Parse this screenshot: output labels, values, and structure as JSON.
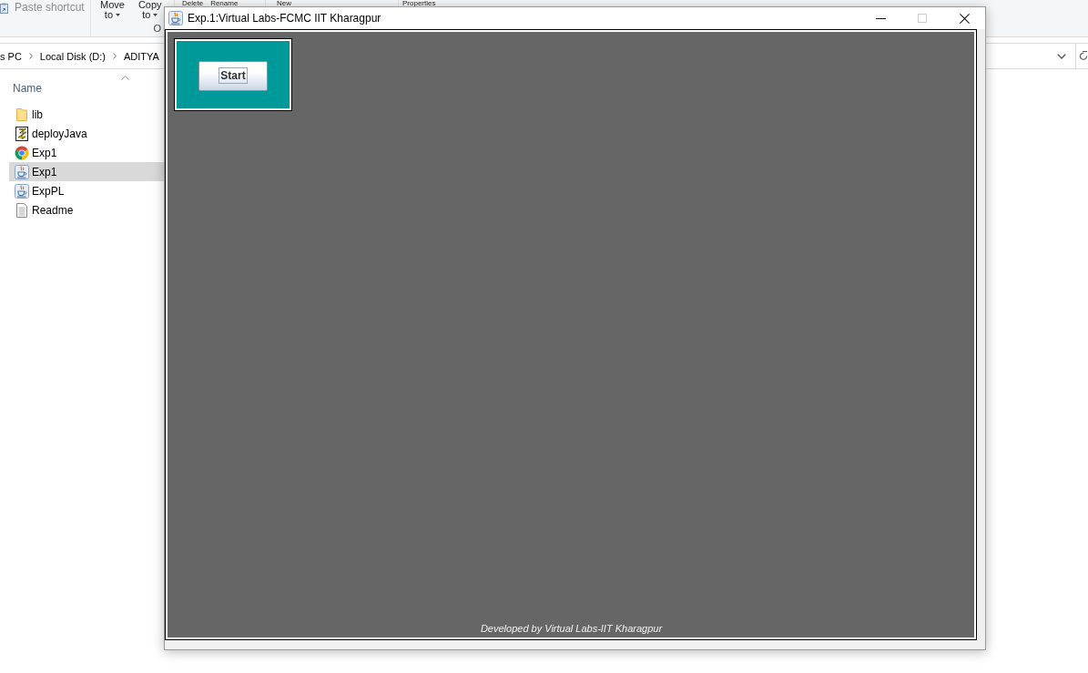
{
  "explorer": {
    "ribbon": {
      "groups": [
        {
          "commands": [
            {
              "kind": "small",
              "label": "Paste shortcut",
              "disabled": true
            }
          ]
        },
        {
          "label": "O",
          "commands": [
            {
              "kind": "large",
              "label": "Move",
              "sub": "to",
              "dropdown": true,
              "disabled": false
            },
            {
              "kind": "large",
              "label": "Copy",
              "sub": "to",
              "dropdown": true,
              "disabled": false
            }
          ]
        },
        {
          "commands": [
            {
              "kind": "large",
              "label": "Delete",
              "dropdown": false,
              "disabled": false
            },
            {
              "kind": "large",
              "label": "Rename",
              "dropdown": false,
              "disabled": false
            }
          ]
        },
        {
          "commands": [
            {
              "kind": "large",
              "label": "New",
              "dropdown": false,
              "disabled": false
            }
          ]
        },
        {
          "commands": [
            {
              "kind": "large",
              "label": "Properties",
              "dropdown": false,
              "disabled": false
            }
          ]
        }
      ]
    },
    "address_bar": {
      "path": [
        "s PC",
        "Local Disk (D:)",
        "ADITYA"
      ]
    },
    "file_list": {
      "column": {
        "label": "Name",
        "sorted": true
      },
      "files": [
        {
          "name": "lib",
          "kind": "folder",
          "selected": false
        },
        {
          "name": "deployJava",
          "kind": "script",
          "selected": false
        },
        {
          "name": "Exp1",
          "kind": "web",
          "selected": false
        },
        {
          "name": "Exp1",
          "kind": "java",
          "selected": true
        },
        {
          "name": "ExpPL",
          "kind": "java",
          "selected": false
        },
        {
          "name": "Readme",
          "kind": "text",
          "selected": false
        }
      ]
    }
  },
  "window": {
    "title": "Exp.1:Virtual Labs-FCMC IIT Kharagpur",
    "controls": [
      {
        "kind": "minimize",
        "disabled": false
      },
      {
        "kind": "maximize",
        "disabled": true
      },
      {
        "kind": "close",
        "disabled": false
      }
    ],
    "start_button": {
      "label": "Start",
      "focused": true
    },
    "footer": "Developed by Virtual Labs-IIT Kharagpur"
  }
}
